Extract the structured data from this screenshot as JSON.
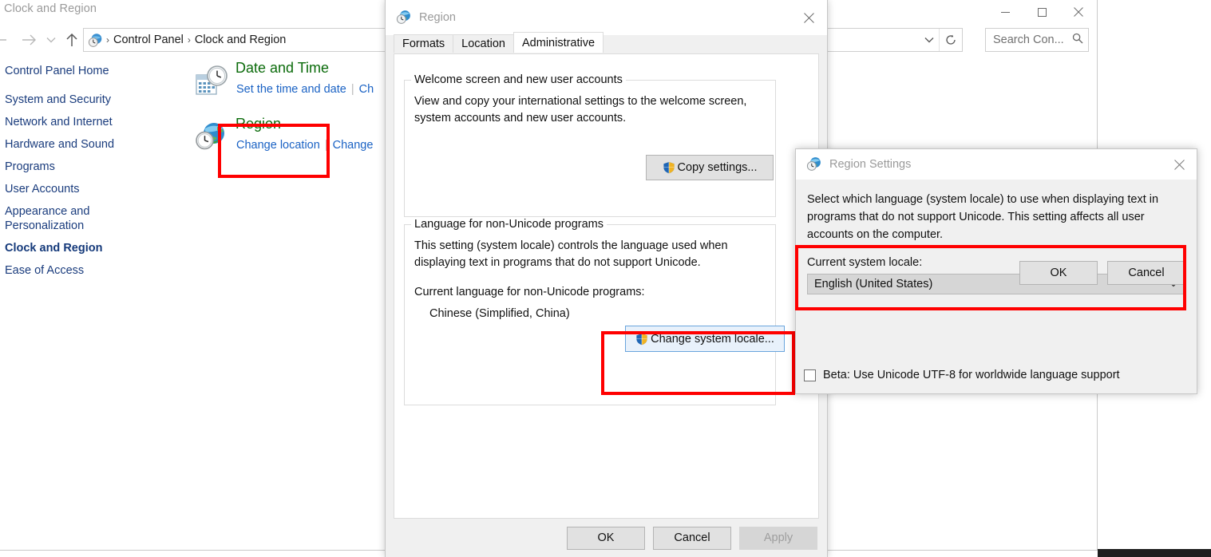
{
  "control_panel": {
    "window_title": "Clock and Region",
    "window_buttons": {
      "minimize": "minimize-button",
      "maximize": "maximize-button",
      "close": "close-button"
    },
    "address": {
      "icon": "control-panel-globe-clock-icon",
      "crumbs": [
        "Control Panel",
        "Clock and Region"
      ],
      "separator": "›",
      "dropdown_icon": "chevron-down-icon",
      "refresh_icon": "refresh-icon"
    },
    "search": {
      "placeholder": "Search Con...",
      "icon": "search-icon"
    },
    "sidebar": {
      "home": "Control Panel Home",
      "items": [
        {
          "label": "System and Security",
          "active": false
        },
        {
          "label": "Network and Internet",
          "active": false
        },
        {
          "label": "Hardware and Sound",
          "active": false
        },
        {
          "label": "Programs",
          "active": false
        },
        {
          "label": "User Accounts",
          "active": false
        },
        {
          "label": "Appearance and\nPersonalization",
          "active": false
        },
        {
          "label": "Clock and Region",
          "active": true
        },
        {
          "label": "Ease of Access",
          "active": false
        }
      ]
    },
    "categories": [
      {
        "icon": "date-and-time-icon",
        "title": "Date and Time",
        "links": [
          "Set the time and date",
          "Ch"
        ]
      },
      {
        "icon": "region-globe-clock-icon",
        "title": "Region",
        "links": [
          "Change location",
          "Change"
        ]
      }
    ]
  },
  "region_dialog": {
    "title": "Region",
    "title_icon": "region-globe-clock-icon",
    "close_icon": "close-icon",
    "tabs": [
      {
        "label": "Formats",
        "active": false
      },
      {
        "label": "Location",
        "active": false
      },
      {
        "label": "Administrative",
        "active": true
      }
    ],
    "welcome_group": {
      "legend": "Welcome screen and new user accounts",
      "description": "View and copy your international settings to the welcome screen, system accounts and new user accounts.",
      "button": {
        "label": "Copy settings...",
        "icon": "uac-shield-icon"
      }
    },
    "language_group": {
      "legend": "Language for non-Unicode programs",
      "description": "This setting (system locale) controls the language used when displaying text in programs that do not support Unicode.",
      "current_label": "Current language for non-Unicode programs:",
      "current_value": "Chinese (Simplified, China)",
      "button": {
        "label": "Change system locale...",
        "icon": "uac-shield-icon"
      }
    },
    "footer": [
      {
        "label": "OK",
        "disabled": false
      },
      {
        "label": "Cancel",
        "disabled": false
      },
      {
        "label": "Apply",
        "disabled": true
      }
    ]
  },
  "region_settings_dialog": {
    "title": "Region Settings",
    "title_icon": "region-globe-clock-icon",
    "close_icon": "close-icon",
    "description": "Select which language (system locale) to use when displaying text in programs that do not support Unicode. This setting affects all user accounts on the computer.",
    "locale_label": "Current system locale:",
    "locale_value": "English (United States)",
    "locale_dropdown_icon": "chevron-down-icon",
    "beta_checkbox": {
      "label": "Beta: Use Unicode UTF-8 for worldwide language support",
      "checked": false
    },
    "footer": [
      {
        "label": "OK"
      },
      {
        "label": "Cancel"
      }
    ]
  },
  "annotations": {
    "highlight_color": "#ff0000",
    "boxes": [
      "region-category-highlight",
      "change-system-locale-highlight",
      "current-system-locale-highlight"
    ]
  }
}
